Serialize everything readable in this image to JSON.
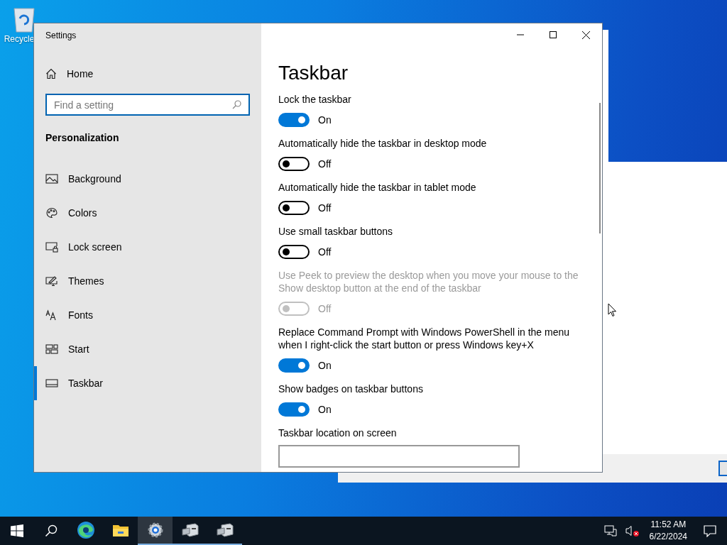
{
  "desktop": {
    "icons": [
      {
        "label": "Recycle"
      }
    ]
  },
  "window": {
    "title": "Settings"
  },
  "sidebar": {
    "home": {
      "label": "Home"
    },
    "search": {
      "placeholder": "Find a setting"
    },
    "section": "Personalization",
    "items": [
      {
        "label": "Background",
        "kind": "background",
        "selected": false
      },
      {
        "label": "Colors",
        "kind": "colors",
        "selected": false
      },
      {
        "label": "Lock screen",
        "kind": "lockscreen",
        "selected": false
      },
      {
        "label": "Themes",
        "kind": "themes",
        "selected": false
      },
      {
        "label": "Fonts",
        "kind": "fonts",
        "selected": false
      },
      {
        "label": "Start",
        "kind": "start",
        "selected": false
      },
      {
        "label": "Taskbar",
        "kind": "taskbar",
        "selected": true
      }
    ]
  },
  "page": {
    "title": "Taskbar",
    "settings": [
      {
        "kind": "toggle",
        "label": "Lock the taskbar",
        "on": true,
        "disabled": false,
        "state": "On"
      },
      {
        "kind": "toggle",
        "label": "Automatically hide the taskbar in desktop mode",
        "on": false,
        "disabled": false,
        "state": "Off"
      },
      {
        "kind": "toggle",
        "label": "Automatically hide the taskbar in tablet mode",
        "on": false,
        "disabled": false,
        "state": "Off"
      },
      {
        "kind": "toggle",
        "label": "Use small taskbar buttons",
        "on": false,
        "disabled": false,
        "state": "Off"
      },
      {
        "kind": "toggle",
        "label": "Use Peek to preview the desktop when you move your mouse to the Show desktop button at the end of the taskbar",
        "on": false,
        "disabled": true,
        "state": "Off"
      },
      {
        "kind": "toggle",
        "label": "Replace Command Prompt with Windows PowerShell in the menu when I right-click the start button or press Windows key+X",
        "on": true,
        "disabled": false,
        "state": "On"
      },
      {
        "kind": "toggle",
        "label": "Show badges on taskbar buttons",
        "on": true,
        "disabled": false,
        "state": "On"
      },
      {
        "kind": "dropdown",
        "label": "Taskbar location on screen"
      }
    ]
  },
  "taskbar": {
    "apps": [
      {
        "kind": "edge",
        "running": false,
        "selected": false
      },
      {
        "kind": "folder",
        "running": false,
        "selected": false
      },
      {
        "kind": "gear",
        "running": true,
        "selected": true
      },
      {
        "kind": "server",
        "running": true,
        "selected": false
      },
      {
        "kind": "server",
        "running": true,
        "selected": false
      }
    ],
    "time": "11:52 AM",
    "date": "6/22/2024"
  }
}
